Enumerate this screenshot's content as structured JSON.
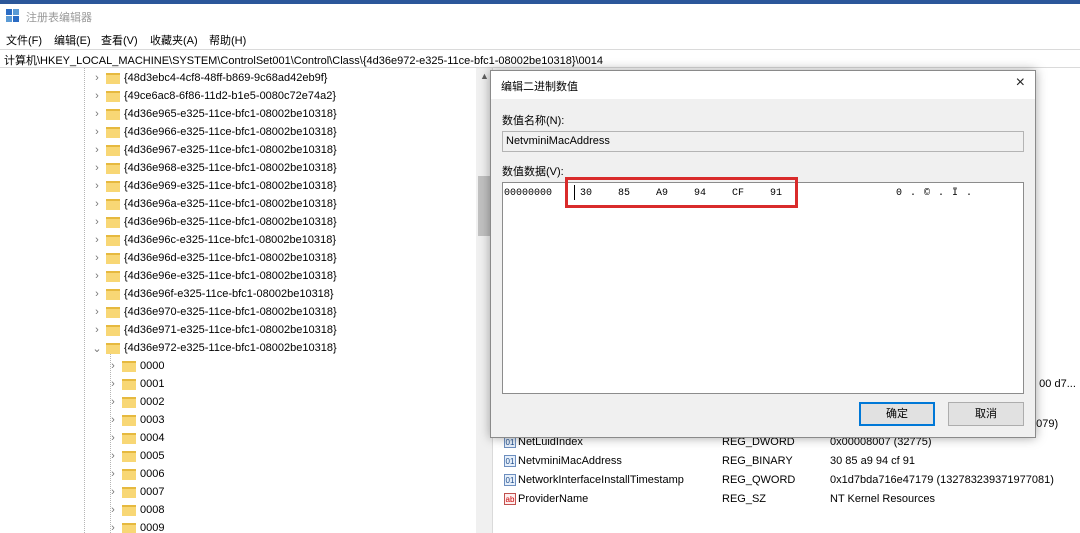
{
  "window": {
    "title": "注册表编辑器",
    "accent": "#2b579a"
  },
  "menu": [
    "文件(F)",
    "编辑(E)",
    "查看(V)",
    "收藏夹(A)",
    "帮助(H)"
  ],
  "address": "计算机\\HKEY_LOCAL_MACHINE\\SYSTEM\\ControlSet001\\Control\\Class\\{4d36e972-e325-11ce-bfc1-08002be10318}\\0014",
  "tree": {
    "class_keys": [
      "{48d3ebc4-4cf8-48ff-b869-9c68ad42eb9f}",
      "{49ce6ac8-6f86-11d2-b1e5-0080c72e74a2}",
      "{4d36e965-e325-11ce-bfc1-08002be10318}",
      "{4d36e966-e325-11ce-bfc1-08002be10318}",
      "{4d36e967-e325-11ce-bfc1-08002be10318}",
      "{4d36e968-e325-11ce-bfc1-08002be10318}",
      "{4d36e969-e325-11ce-bfc1-08002be10318}",
      "{4d36e96a-e325-11ce-bfc1-08002be10318}",
      "{4d36e96b-e325-11ce-bfc1-08002be10318}",
      "{4d36e96c-e325-11ce-bfc1-08002be10318}",
      "{4d36e96d-e325-11ce-bfc1-08002be10318}",
      "{4d36e96e-e325-11ce-bfc1-08002be10318}",
      "{4d36e96f-e325-11ce-bfc1-08002be10318}",
      "{4d36e970-e325-11ce-bfc1-08002be10318}",
      "{4d36e971-e325-11ce-bfc1-08002be10318}",
      "{4d36e972-e325-11ce-bfc1-08002be10318}"
    ],
    "subkeys": [
      "0000",
      "0001",
      "0002",
      "0003",
      "0004",
      "0005",
      "0006",
      "0007",
      "0008",
      "0009"
    ]
  },
  "values": [
    {
      "icon": "binary",
      "name": "NetLuidIndex",
      "type": "REG_DWORD",
      "data": "0x00008007 (32775)"
    },
    {
      "icon": "binary",
      "name": "NetvminiMacAddress",
      "type": "REG_BINARY",
      "data": "30 85 a9 94 cf 91"
    },
    {
      "icon": "binary",
      "name": "NetworkInterfaceInstallTimestamp",
      "type": "REG_QWORD",
      "data": "0x1d7bda716e47179 (132783239371977081)"
    },
    {
      "icon": "string",
      "name": "ProviderName",
      "type": "REG_SZ",
      "data": "NT Kernel Resources"
    }
  ],
  "clipped": [
    "9 00 d7...",
    "6079)"
  ],
  "dialog": {
    "title": "编辑二进制数值",
    "close": "×",
    "name_label": "数值名称(N):",
    "name_value": "NetvminiMacAddress",
    "data_label": "数值数据(V):",
    "offset": "00000000",
    "bytes": [
      "30",
      "85",
      "A9",
      "94",
      "CF",
      "91"
    ],
    "ascii": "0 . © . Ï .",
    "ok": "确定",
    "cancel": "取消"
  }
}
